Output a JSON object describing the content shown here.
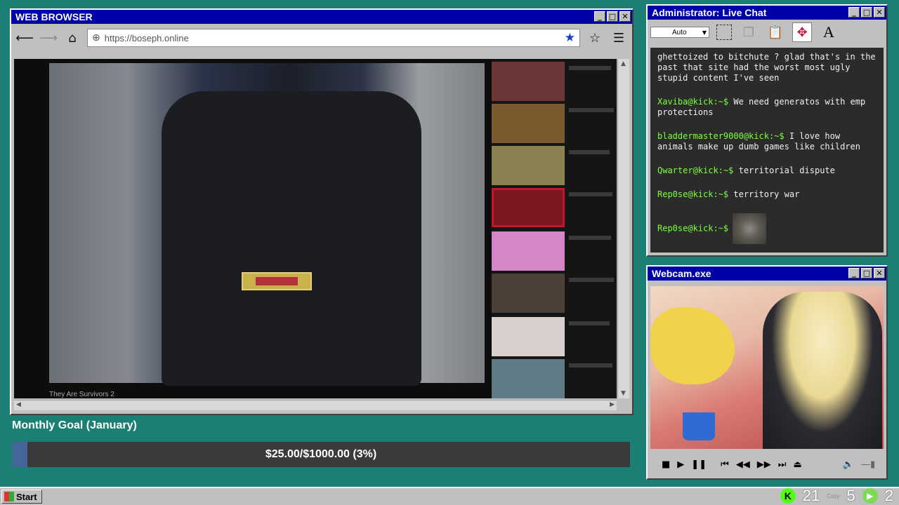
{
  "browser": {
    "title": "WEB BROWSER",
    "url": "https://boseph.online",
    "video_caption": "They Are Survivors 2"
  },
  "goal": {
    "title": "Monthly Goal (January)",
    "amount_text": "$25.00/$1000.00 (3%)",
    "progress_fraction": 0.025,
    "fill_color": "#44669a"
  },
  "chat": {
    "title": "Administrator: Live Chat",
    "select_value": "Auto",
    "messages": [
      {
        "user": "",
        "text": "ghettoized to bitchute ? glad that's in the past that site had the worst most ugly stupid content I've seen"
      },
      {
        "user": "Xaviba@kick:~$",
        "text": " We need generatos with emp protections"
      },
      {
        "user": "bladdermaster9000@kick:~$",
        "text": " I love how animals make up dumb games like children"
      },
      {
        "user": "Qwarter@kick:~$",
        "text": " territorial dispute"
      },
      {
        "user": "Rep0se@kick:~$",
        "text": " territory war"
      },
      {
        "user": "Rep0se@kick:~$",
        "text": ""
      }
    ],
    "username_color": "#7bff3a"
  },
  "webcam": {
    "title": "Webcam.exe"
  },
  "taskbar": {
    "start_label": "Start",
    "tray_kick_count": "21",
    "tray_tiny_label": "Cozy",
    "tray_count_2": "5",
    "tray_rumble_count": "2"
  },
  "icons": {
    "window_controls": [
      "minimize-icon",
      "maximize-icon",
      "close-icon"
    ],
    "nav": [
      "back-arrow-icon",
      "forward-arrow-icon",
      "home-icon"
    ],
    "addr": [
      "globe-icon",
      "star-filled-icon",
      "star-outline-icon",
      "menu-icon"
    ]
  }
}
